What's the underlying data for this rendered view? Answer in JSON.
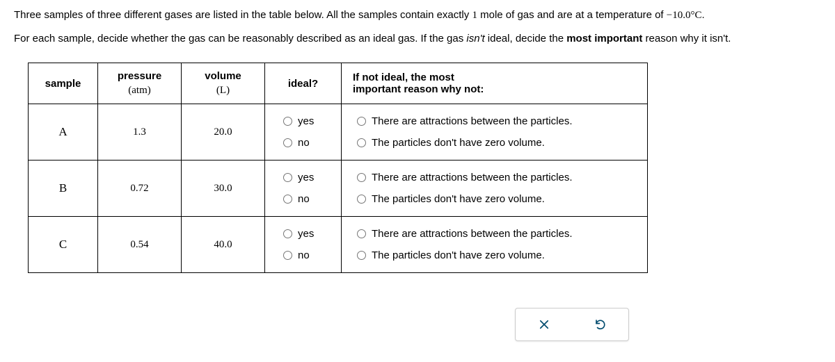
{
  "intro": {
    "line1_pre": "Three samples of three different gases are listed in the table below. All the samples contain exactly ",
    "one_mole": "1",
    "line1_mid": " mole of gas and are at a temperature of ",
    "temp": "−10.0°C",
    "line1_end": ".",
    "line2_pre": "For each sample, decide whether the gas can be reasonably described as an ideal gas. If the gas ",
    "isnt": "isn't",
    "line2_mid": " ideal, decide the ",
    "most_important": "most important",
    "line2_end": " reason why it isn't."
  },
  "headers": {
    "sample": "sample",
    "pressure_top": "pressure",
    "pressure_unit": "(atm)",
    "volume_top": "volume",
    "volume_unit": "(L)",
    "ideal": "ideal?",
    "reason_top": "If not ideal, the most",
    "reason_bottom": "important reason why not:"
  },
  "options": {
    "yes": "yes",
    "no": "no",
    "attractions": "There are attractions between the particles.",
    "volume": "The particles don't have zero volume."
  },
  "rows": [
    {
      "sample": "A",
      "pressure": "1.3",
      "volume": "20.0"
    },
    {
      "sample": "B",
      "pressure": "0.72",
      "volume": "30.0"
    },
    {
      "sample": "C",
      "pressure": "0.54",
      "volume": "40.0"
    }
  ]
}
